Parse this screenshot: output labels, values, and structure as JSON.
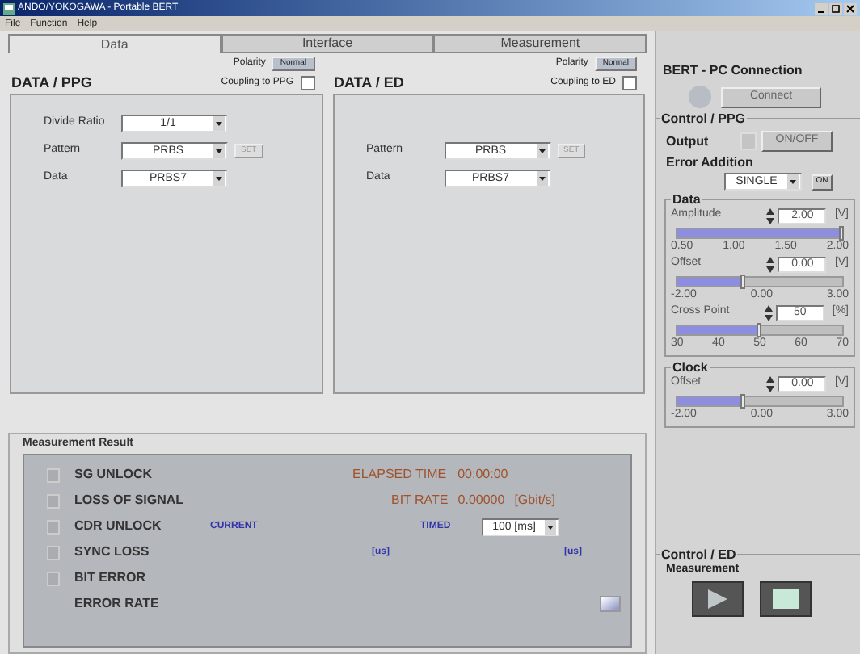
{
  "window": {
    "title": "ANDO/YOKOGAWA - Portable BERT"
  },
  "menu": [
    "File",
    "Function",
    "Help"
  ],
  "tabs": [
    {
      "label": "Data",
      "selected": true
    },
    {
      "label": "Interface",
      "selected": false
    },
    {
      "label": "Measurement",
      "selected": false
    }
  ],
  "panels": [
    {
      "title": "DATA / PPG",
      "polarity_label": "Polarity",
      "polarity_button": "Normal",
      "coupling_label": "Coupling to PPG",
      "coupling_checked": false,
      "fields": [
        {
          "label": "Divide Ratio",
          "value": "1/1"
        },
        {
          "label": "Pattern",
          "value": "PRBS",
          "button": "SET"
        },
        {
          "label": "Data",
          "value": "PRBS7"
        }
      ]
    },
    {
      "title": "DATA / ED",
      "polarity_label": "Polarity",
      "polarity_button": "Normal",
      "coupling_label": "Coupling to ED",
      "coupling_checked": false,
      "fields": [
        {
          "label": "Pattern",
          "value": "PRBS",
          "button": "SET"
        },
        {
          "label": "Data",
          "value": "PRBS7"
        }
      ]
    }
  ],
  "measurement": {
    "title": "Measurement Result",
    "alarms": [
      {
        "label": "SG UNLOCK",
        "lit": false
      },
      {
        "label": "LOSS OF SIGNAL",
        "lit": false
      },
      {
        "label": "CDR UNLOCK",
        "lit": false
      },
      {
        "label": "SYNC LOSS",
        "lit": false
      },
      {
        "label": "BIT ERROR",
        "lit": false
      }
    ],
    "error_rate_label": "ERROR RATE",
    "elapsed_label": "ELAPSED TIME",
    "elapsed_value": "00:00:00",
    "bit_rate_label": "BIT RATE",
    "bit_rate_value": "0.00000",
    "bit_rate_unit": "[Gbit/s]",
    "current_label": "CURRENT",
    "timed_label": "TIMED",
    "timed_select": "100 [ms]",
    "current_unit": "[us]",
    "timed_unit": "[us]"
  },
  "connection": {
    "title": "BERT - PC Connection",
    "connected": false,
    "button": "Connect"
  },
  "control_ppg": {
    "title": "Control / PPG",
    "output_label": "Output",
    "output_on": false,
    "output_button": "ON/OFF",
    "error_label": "Error Addition",
    "error_select": "SINGLE",
    "error_button": "ON"
  },
  "data_group": {
    "title": "Data",
    "params": [
      {
        "label": "Amplitude",
        "value": "2.00",
        "unit": "[V]",
        "level": 1.0,
        "ticks": [
          "0.50",
          "1.00",
          "1.50",
          "2.00"
        ]
      },
      {
        "label": "Offset",
        "value": "0.00",
        "unit": "[V]",
        "level": 0.4,
        "ticks": [
          "-2.00",
          "0.00",
          "3.00"
        ]
      },
      {
        "label": "Cross Point",
        "value": "50",
        "unit": "[%]",
        "level": 0.5,
        "ticks": [
          "30",
          "40",
          "50",
          "60",
          "70"
        ]
      }
    ]
  },
  "clock_group": {
    "title": "Clock",
    "params": [
      {
        "label": "Offset",
        "value": "0.00",
        "unit": "[V]",
        "level": 0.4,
        "ticks": [
          "-2.00",
          "0.00",
          "3.00"
        ]
      }
    ]
  },
  "control_ed": {
    "title": "Control / ED",
    "subtitle": "Measurement"
  }
}
